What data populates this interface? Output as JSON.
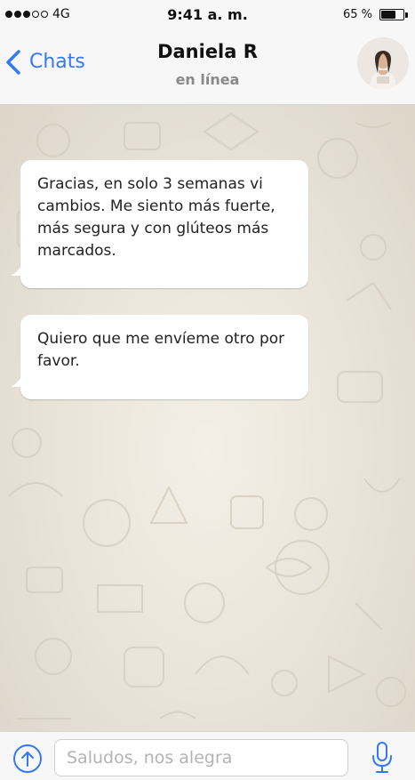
{
  "status_bar": {
    "signal_dots_filled": 3,
    "signal_dots_total": 5,
    "carrier": "4G",
    "time": "9:41 a. m.",
    "battery_percent_label": "65 %",
    "battery_level": 0.65
  },
  "header": {
    "back_label": "Chats",
    "contact_name": "Daniela R",
    "contact_status": "en línea",
    "accent_color": "#3478f6"
  },
  "messages": [
    {
      "text": "Gracias, en solo 3 semanas vi cambios. Me siento más fuerte, más segura y con glúteos más marcados."
    },
    {
      "text": "Quiero que me envíeme otro por favor."
    }
  ],
  "input_bar": {
    "placeholder": "Saludos, nos alegra",
    "attach_icon": "arrow-up-circle-icon",
    "mic_icon": "microphone-icon"
  }
}
